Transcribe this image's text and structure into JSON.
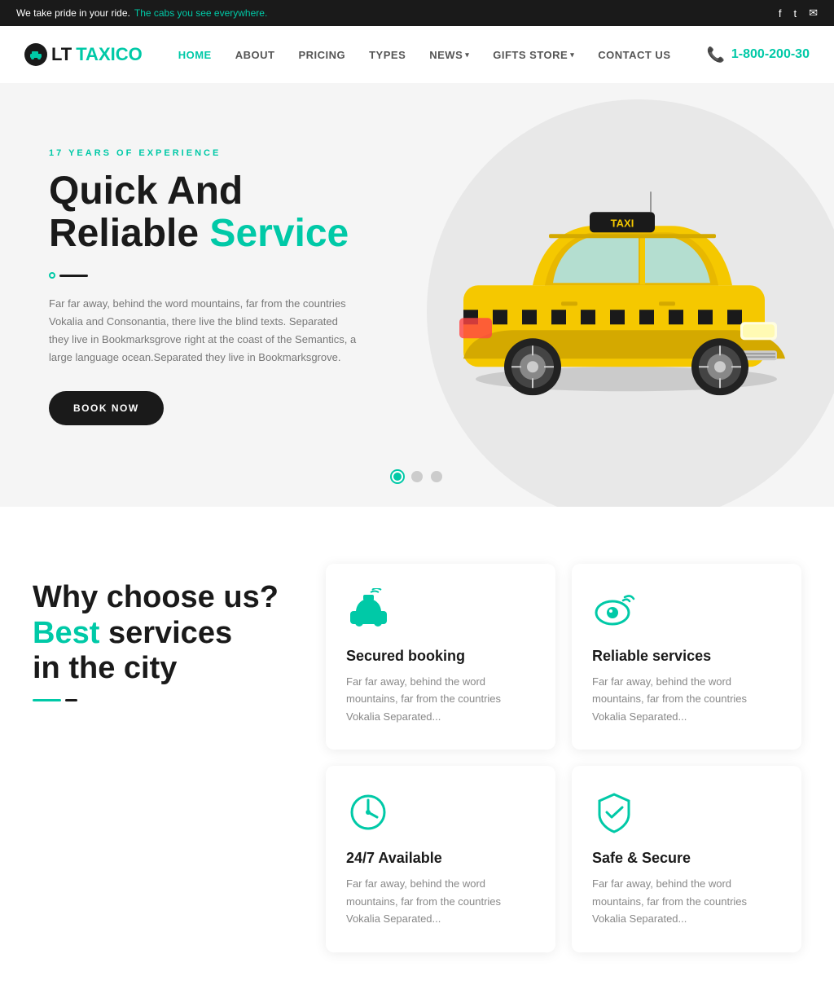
{
  "topbar": {
    "message": "We take pride in your ride.",
    "highlight": "The cabs you see everywhere.",
    "social": [
      "facebook",
      "twitter",
      "email"
    ]
  },
  "header": {
    "logo": {
      "prefix": "LT",
      "name": "TAXICO"
    },
    "nav": [
      {
        "label": "HOME",
        "active": true,
        "has_dropdown": false
      },
      {
        "label": "ABOUT",
        "active": false,
        "has_dropdown": false
      },
      {
        "label": "PRICING",
        "active": false,
        "has_dropdown": false
      },
      {
        "label": "TYPES",
        "active": false,
        "has_dropdown": false
      },
      {
        "label": "NEWS",
        "active": false,
        "has_dropdown": true
      },
      {
        "label": "GIFTS STORE",
        "active": false,
        "has_dropdown": true
      },
      {
        "label": "CONTACT US",
        "active": false,
        "has_dropdown": false
      }
    ],
    "phone": "1-800-200-30"
  },
  "hero": {
    "experience_label": "17 YEARS OF EXPERIENCE",
    "title_line1": "Quick And",
    "title_line2": "Reliable",
    "title_highlight": "Service",
    "description": "Far far away, behind the word mountains, far from the countries Vokalia and Consonantia, there live the blind texts. Separated they live in Bookmarksgrove right at the coast of the Semantics, a large language ocean.Separated they live in Bookmarksgrove.",
    "btn_label": "BOOK NOW",
    "dots": [
      {
        "active": true
      },
      {
        "active": false
      },
      {
        "active": false
      }
    ]
  },
  "why_section": {
    "line1": "Why choose us?",
    "line2_normal": "",
    "line2_highlight": "Best",
    "line2_rest": " services",
    "line3": "in the city"
  },
  "cards": [
    {
      "icon": "taxi-icon",
      "title": "Secured booking",
      "description": "Far far away, behind the word mountains, far from the countries Vokalia Separated..."
    },
    {
      "icon": "eye-icon",
      "title": "Reliable services",
      "description": "Far far away, behind the word mountains, far from the countries Vokalia Separated..."
    },
    {
      "icon": "clock-icon",
      "title": "24/7 Available",
      "description": "Far far away, behind the word mountains, far from the countries Vokalia Separated..."
    },
    {
      "icon": "shield-icon",
      "title": "Safe & Secure",
      "description": "Far far away, behind the word mountains, far from the countries Vokalia Separated..."
    }
  ],
  "colors": {
    "accent": "#00c9a7",
    "dark": "#1a1a1a",
    "light_bg": "#f5f5f5"
  }
}
